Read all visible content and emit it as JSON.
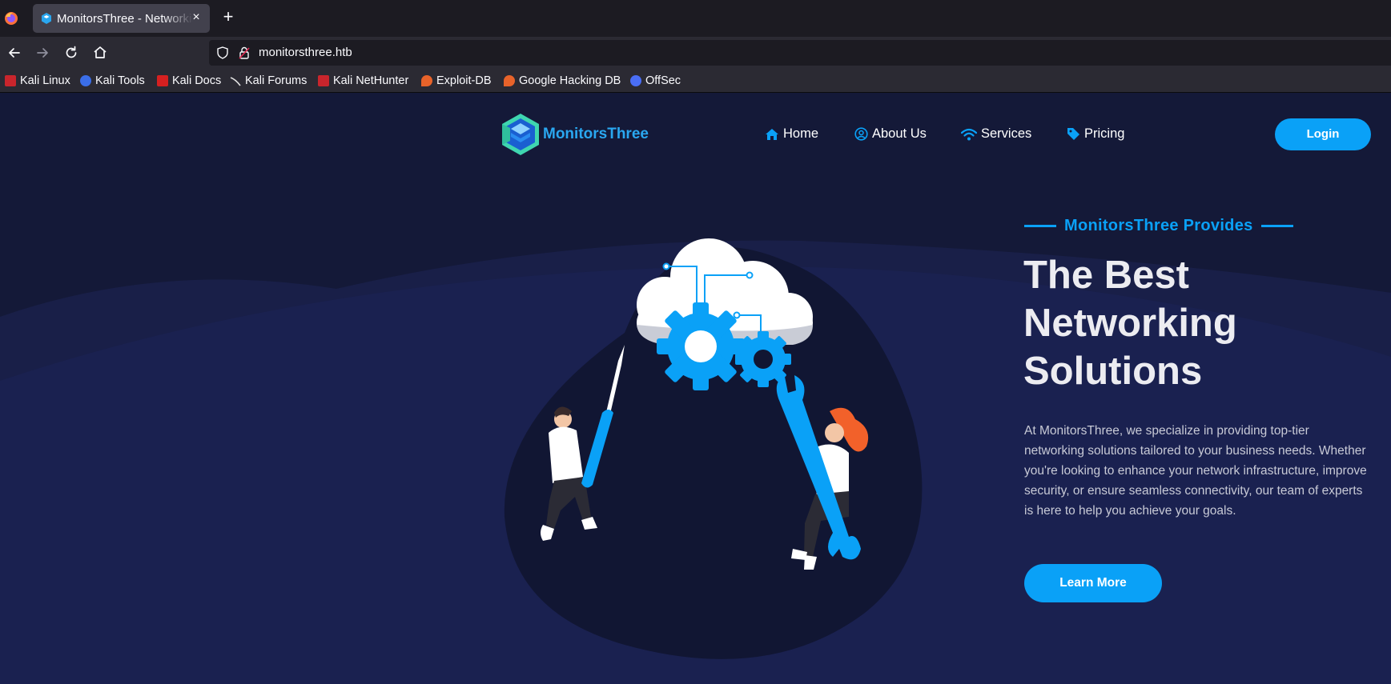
{
  "browser": {
    "tab": {
      "title": "MonitorsThree - Networking Solutions",
      "close_glyph": "×"
    },
    "new_tab_glyph": "+",
    "url": "monitorsthree.htb",
    "bookmarks": [
      {
        "label": "Kali Linux",
        "icon": "kali-icon",
        "color": "#c9252c"
      },
      {
        "label": "Kali Tools",
        "icon": "kali-tools-icon",
        "color": "#3b6ee8"
      },
      {
        "label": "Kali Docs",
        "icon": "kali-docs-icon",
        "color": "#d62020"
      },
      {
        "label": "Kali Forums",
        "icon": "kali-forums-icon",
        "color": "#e0e0e0"
      },
      {
        "label": "Kali NetHunter",
        "icon": "kali-nethunter-icon",
        "color": "#c9252c"
      },
      {
        "label": "Exploit-DB",
        "icon": "exploit-db-icon",
        "color": "#e8632a"
      },
      {
        "label": "Google Hacking DB",
        "icon": "ghdb-icon",
        "color": "#e8632a"
      },
      {
        "label": "OffSec",
        "icon": "offsec-icon",
        "color": "#4a6ef5"
      }
    ]
  },
  "site": {
    "logo_text": "MonitorsThree",
    "nav": [
      {
        "label": "Home",
        "icon": "home-icon"
      },
      {
        "label": "About Us",
        "icon": "user-circle-icon"
      },
      {
        "label": "Services",
        "icon": "wifi-icon"
      },
      {
        "label": "Pricing",
        "icon": "tag-icon"
      }
    ],
    "login_label": "Login",
    "hero": {
      "eyebrow": "MonitorsThree Provides",
      "title_lines": [
        "The Best",
        "Networking",
        "Solutions"
      ],
      "description": "At MonitorsThree, we specialize in providing top-tier networking solutions tailored to your business needs. Whether you're looking to enhance your network infrastructure, improve security, or ensure seamless connectivity, our team of experts is here to help you achieve your goals.",
      "cta_label": "Learn More"
    },
    "colors": {
      "accent": "#0aa1f7",
      "background": "#151a3a",
      "logo_green": "#3fd6b0"
    }
  }
}
